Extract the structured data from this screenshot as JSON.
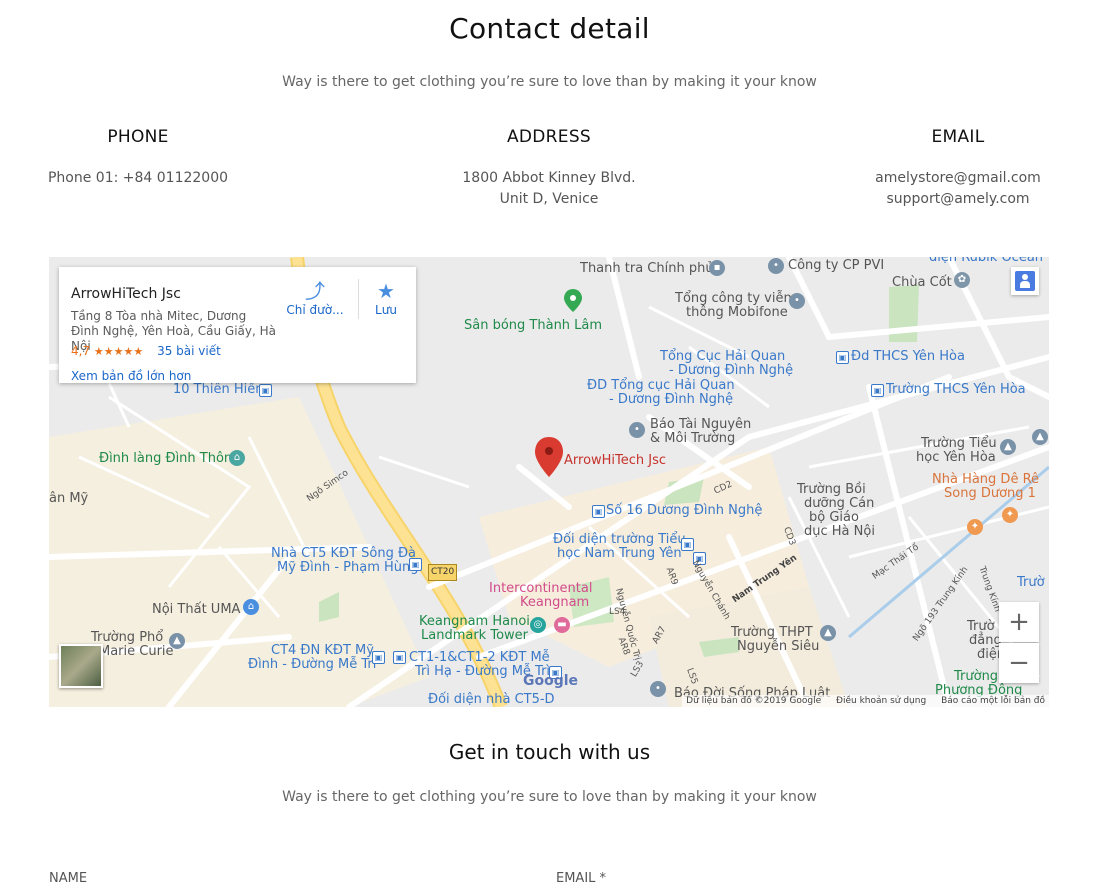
{
  "contact": {
    "title": "Contact detail",
    "subtitle": "Way is there to get clothing you’re sure to love than by making it your know",
    "phone": {
      "heading": "PHONE",
      "line1": "Phone 01: +84 01122000"
    },
    "address": {
      "heading": "ADDRESS",
      "line1": "1800 Abbot Kinney Blvd.",
      "line2": "Unit D, Venice"
    },
    "email": {
      "heading": "EMAIL",
      "line1": "amelystore@gmail.com",
      "line2": "support@amely.com"
    }
  },
  "map": {
    "card": {
      "name": "ArrowHiTech Jsc",
      "address": "Tầng 8 Tòa nhà Mitec, Dương Đình Nghệ, Yên Hoà, Cầu Giấy, Hà Nội",
      "rating": "4,7",
      "stars": "★★★★★",
      "reviews": "35 bài viết",
      "directions": "Chỉ đườ...",
      "save": "Lưu",
      "larger_map": "Xem bản đồ lớn hơn"
    },
    "pin_label": "ArrowHiTech Jsc",
    "places": [
      {
        "text": "Thanh tra Chính phủ"
      },
      {
        "text": "Công ty CP PVI"
      },
      {
        "text": "điện Rubik Ocean"
      },
      {
        "text": "Chùa Cốt"
      },
      {
        "text": "Sân bóng Thành Lâm"
      },
      {
        "text": "Tổng công ty viễn"
      },
      {
        "text": "thông Mobifone"
      },
      {
        "text": "Tổng Cục Hải Quan"
      },
      {
        "text": "- Dương Đình Nghệ"
      },
      {
        "text": "ĐD Tổng cục Hải Quan"
      },
      {
        "text": "- Dương Đình Nghệ"
      },
      {
        "text": "Đd THCS Yên Hòa"
      },
      {
        "text": "Trường THCS Yên Hòa"
      },
      {
        "text": "10 Thiên Hiền"
      },
      {
        "text": "Báo Tài Nguyên"
      },
      {
        "text": "& Môi Trường"
      },
      {
        "text": "Trường Tiểu"
      },
      {
        "text": "học Yên Hòa"
      },
      {
        "text": "Đình làng Đình Thôn"
      },
      {
        "text": "Nhà Hàng Dê Rê"
      },
      {
        "text": "Song Dương 1"
      },
      {
        "text": "ân Mỹ"
      },
      {
        "text": "Trường Bồi"
      },
      {
        "text": "dưỡng Cán"
      },
      {
        "text": "bộ Giáo"
      },
      {
        "text": "dục Hà Nội"
      },
      {
        "text": "Số 16 Dương Đình Nghệ"
      },
      {
        "text": "Đối diện trường Tiểu"
      },
      {
        "text": "học Nam Trung Yên"
      },
      {
        "text": "Nhà CT5 KĐT Sông Đà"
      },
      {
        "text": "Mỹ Đình - Phạm Hùng"
      },
      {
        "text": "Intercontinental"
      },
      {
        "text": "Keangnam"
      },
      {
        "text": "Nội Thất UMA"
      },
      {
        "text": "Keangnam Hanoi"
      },
      {
        "text": "Landmark Tower"
      },
      {
        "text": "Trường Phổ"
      },
      {
        "text": "Marie Curie"
      },
      {
        "text": "CT4 ĐN KĐT Mỹ"
      },
      {
        "text": "Đình - Đường Mễ Trì"
      },
      {
        "text": "CT1-1&CT1-2 KĐT Mễ"
      },
      {
        "text": "Trì Hạ - Đường Mễ Trì"
      },
      {
        "text": "Trường THPT"
      },
      {
        "text": "Nguyễn Siêu"
      },
      {
        "text": "Trườ"
      },
      {
        "text": "đẳng"
      },
      {
        "text": "điện"
      },
      {
        "text": "Trường"
      },
      {
        "text": "Phương Đông"
      },
      {
        "text": "Đối diện nhà CT5-D"
      },
      {
        "text": "Báo Đời Sống Pháp Luật"
      },
      {
        "text": "Trườ"
      }
    ],
    "streets": [
      "Ngõ Simco",
      "CT20",
      "CD2",
      "CD3",
      "Nam Trung Yên",
      "AR9",
      "Nguyễn Chánh",
      "AR7",
      "AR8",
      "LS4",
      "LS3",
      "LS5",
      "Nguyễn Quốc Trị",
      "Mạc Thái Tổ",
      "Ngõ 193 Trung Kính",
      "Trung Kính"
    ],
    "footer": {
      "data": "Dữ liệu bản đồ ©2019 Google",
      "terms": "Điều khoản sử dụng",
      "report": "Báo cáo một lỗi bản đồ"
    },
    "google": "Google",
    "zoom_in": "+",
    "zoom_out": "−"
  },
  "touch": {
    "title": "Get in touch with us",
    "subtitle": "Way is there to get clothing you’re sure to love than by making it your know",
    "name_label": "NAME",
    "email_label": "EMAIL *"
  }
}
